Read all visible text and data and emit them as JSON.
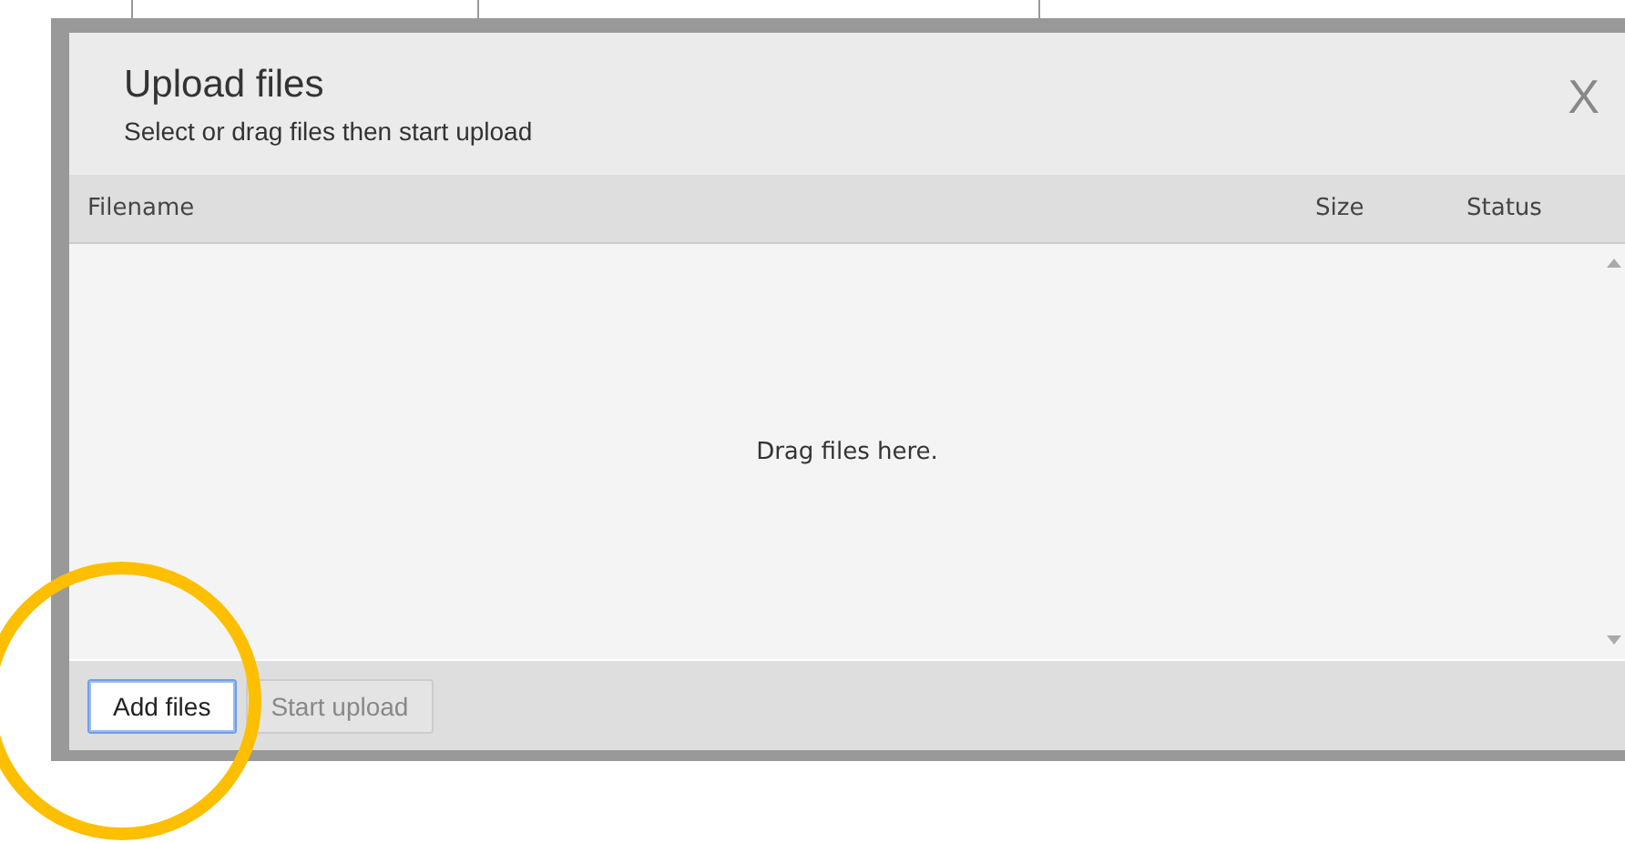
{
  "dialog": {
    "title": "Upload files",
    "subtitle": "Select or drag files then start upload",
    "close": "X",
    "columns": [
      "Filename",
      "Size",
      "Status"
    ],
    "empty_message": "Drag files here.",
    "buttons": [
      {
        "label": "Add files",
        "disabled": false,
        "focused": true
      },
      {
        "label": "Start upload",
        "disabled": true,
        "focused": false
      }
    ]
  }
}
